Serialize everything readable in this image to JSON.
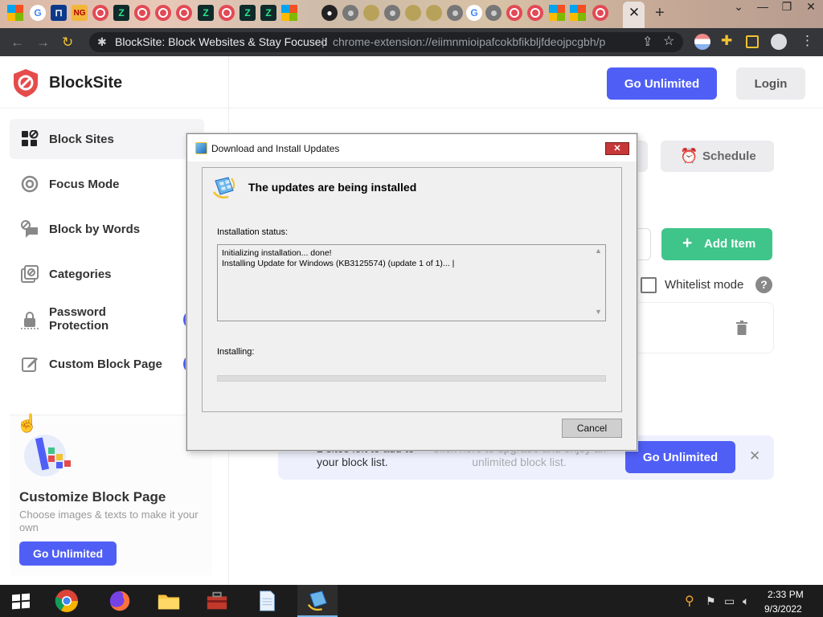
{
  "browser": {
    "tab_favicons": [
      "microsoft-icon",
      "google-icon",
      "blue-app-icon",
      "ng-icon",
      "blocksite-icon",
      "zapier-icon",
      "blocksite-icon",
      "blocksite-icon",
      "blocksite-icon",
      "zapier-icon",
      "blocksite-icon",
      "zapier-icon",
      "zapier-icon",
      "microsoft-icon",
      "github-icon",
      "chrome-icon",
      "gold-icon",
      "chrome-icon",
      "gold-icon",
      "gold-icon",
      "chrome-icon",
      "google-icon",
      "chrome-icon",
      "blocksite-icon",
      "blocksite-icon",
      "microsoft-icon",
      "microsoft-icon",
      "blocksite-icon"
    ],
    "tab_close": "✕",
    "new_tab": "+",
    "omnibox_title": "BlockSite: Block Websites & Stay Focused",
    "omnibox_separator": "|",
    "omnibox_url": "chrome-extension://eiimnmioipafcokbfikbljfdeojpcgbh/pu..."
  },
  "header": {
    "brand": "BlockSite",
    "go_unlimited": "Go Unlimited",
    "login": "Login"
  },
  "sidebar": {
    "items": [
      {
        "label": "Block Sites",
        "icon": "grid-icon",
        "active": true
      },
      {
        "label": "Focus Mode",
        "icon": "target-icon"
      },
      {
        "label": "Block by Words",
        "icon": "chat-block-icon"
      },
      {
        "label": "Categories",
        "icon": "categories-icon"
      },
      {
        "label": "Password\nProtection",
        "icon": "lock-icon",
        "locked": true
      },
      {
        "label": "Custom Block Page",
        "icon": "edit-page-icon",
        "locked": true
      }
    ]
  },
  "promo": {
    "title": "Customize Block Page",
    "description": "Choose images & texts to make it your own",
    "button": "Go Unlimited"
  },
  "main": {
    "schedule": "Schedule",
    "add_item": "Add Item",
    "whitelist_mode": "Whitelist mode",
    "help": "?",
    "banner": {
      "left_text": "2 sites left to add to your block list.",
      "mid_text": "Click here to upgrade and enjoy an unlimited block list.",
      "button": "Go Unlimited",
      "close": "✕"
    }
  },
  "dialog": {
    "title": "Download and Install Updates",
    "close": "✕",
    "heading": "The updates are being installed",
    "status_label": "Installation status:",
    "log_lines": [
      "Initializing installation... done!",
      "Installing Update for Windows (KB3125574) (update 1 of 1)... |"
    ],
    "installing_label": "Installing:",
    "progress_fraction": 0.0,
    "cancel": "Cancel"
  },
  "taskbar": {
    "apps": [
      "chrome-icon",
      "firefox-icon",
      "file-explorer-icon",
      "toolbox-icon",
      "notepad-icon",
      "windows-update-icon"
    ],
    "time": "2:33 PM",
    "date": "9/3/2022"
  },
  "colors": {
    "accent": "#4f5ff6",
    "add_green": "#3fc48a",
    "dialog_close_red": "#c63838",
    "taskbar": "#1c1c1c"
  }
}
